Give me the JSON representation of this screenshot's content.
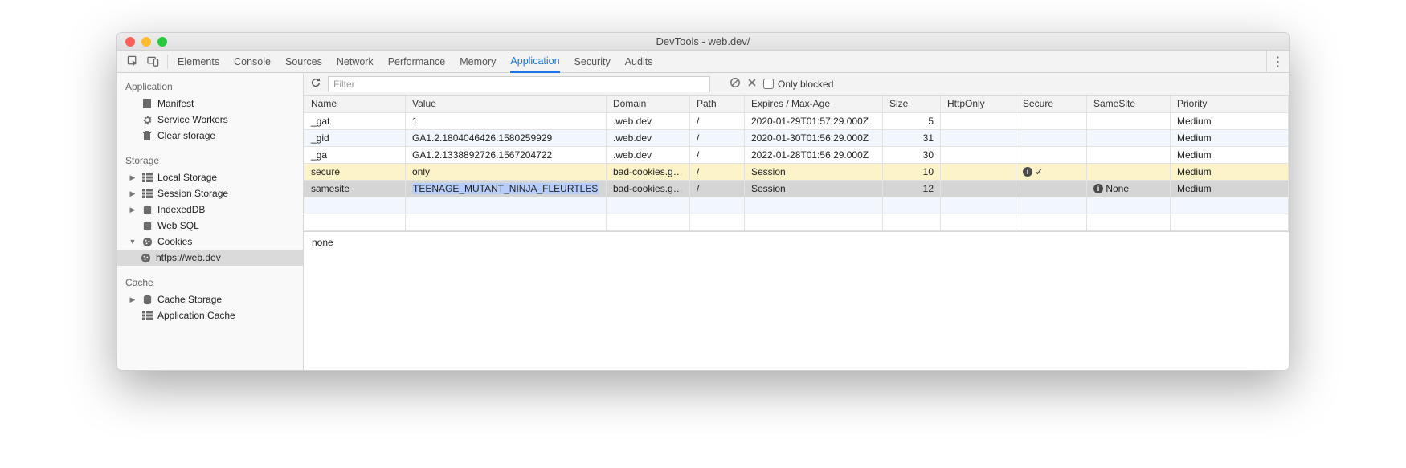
{
  "window_title": "DevTools - web.dev/",
  "toolbar_tabs": [
    "Elements",
    "Console",
    "Sources",
    "Network",
    "Performance",
    "Memory",
    "Application",
    "Security",
    "Audits"
  ],
  "active_tab": "Application",
  "sidebar": {
    "sections": [
      {
        "title": "Application",
        "items": [
          {
            "label": "Manifest",
            "icon": "doc",
            "expandable": false
          },
          {
            "label": "Service Workers",
            "icon": "gear",
            "expandable": false
          },
          {
            "label": "Clear storage",
            "icon": "trash",
            "expandable": false
          }
        ]
      },
      {
        "title": "Storage",
        "items": [
          {
            "label": "Local Storage",
            "icon": "db-grid",
            "expandable": true,
            "expanded": false
          },
          {
            "label": "Session Storage",
            "icon": "db-grid",
            "expandable": true,
            "expanded": false
          },
          {
            "label": "IndexedDB",
            "icon": "db",
            "expandable": true,
            "expanded": false
          },
          {
            "label": "Web SQL",
            "icon": "db",
            "expandable": false
          },
          {
            "label": "Cookies",
            "icon": "cookie",
            "expandable": true,
            "expanded": true,
            "children": [
              {
                "label": "https://web.dev",
                "icon": "cookie",
                "selected": true
              }
            ]
          }
        ]
      },
      {
        "title": "Cache",
        "items": [
          {
            "label": "Cache Storage",
            "icon": "db",
            "expandable": true,
            "expanded": false
          },
          {
            "label": "Application Cache",
            "icon": "db-grid",
            "expandable": false
          }
        ]
      }
    ]
  },
  "filterbar": {
    "placeholder": "Filter",
    "only_blocked_label": "Only blocked"
  },
  "columns": [
    "Name",
    "Value",
    "Domain",
    "Path",
    "Expires / Max-Age",
    "Size",
    "HttpOnly",
    "Secure",
    "SameSite",
    "Priority"
  ],
  "rows": [
    {
      "name": "_gat",
      "value": "1",
      "domain": ".web.dev",
      "path": "/",
      "expires": "2020-01-29T01:57:29.000Z",
      "size": "5",
      "httpOnly": "",
      "secure": "",
      "sameSite": "",
      "priority": "Medium",
      "state": "normal"
    },
    {
      "name": "_gid",
      "value": "GA1.2.1804046426.1580259929",
      "domain": ".web.dev",
      "path": "/",
      "expires": "2020-01-30T01:56:29.000Z",
      "size": "31",
      "httpOnly": "",
      "secure": "",
      "sameSite": "",
      "priority": "Medium",
      "state": "normal"
    },
    {
      "name": "_ga",
      "value": "GA1.2.1338892726.1567204722",
      "domain": ".web.dev",
      "path": "/",
      "expires": "2022-01-28T01:56:29.000Z",
      "size": "30",
      "httpOnly": "",
      "secure": "",
      "sameSite": "",
      "priority": "Medium",
      "state": "normal"
    },
    {
      "name": "secure",
      "value": "only",
      "domain": "bad-cookies.g…",
      "path": "/",
      "expires": "Session",
      "size": "10",
      "httpOnly": "",
      "secure_info": true,
      "secure_check": true,
      "sameSite": "",
      "priority": "Medium",
      "state": "warn"
    },
    {
      "name": "samesite",
      "value": "TEENAGE_MUTANT_NINJA_FLEURTLES",
      "domain": "bad-cookies.g…",
      "path": "/",
      "expires": "Session",
      "size": "12",
      "httpOnly": "",
      "secure": "",
      "sameSite_info": true,
      "sameSite": "None",
      "priority": "Medium",
      "state": "selected"
    }
  ],
  "detail_value": "none"
}
